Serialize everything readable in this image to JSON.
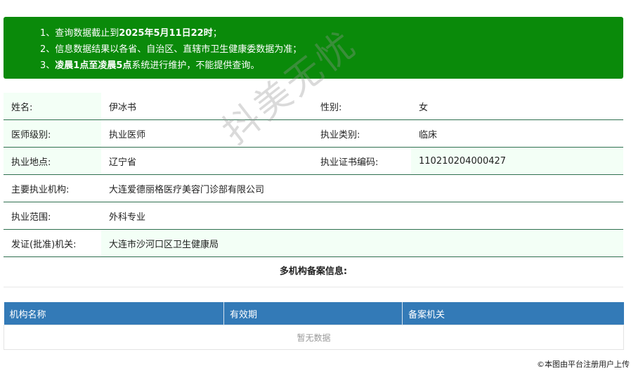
{
  "notice": {
    "line1_prefix": "1、查询数据截止到",
    "line1_bold": "2025年5月11日22时",
    "line1_suffix": "；",
    "line2": "2、信息数据结果以各省、自治区、直辖市卫生健康委数据为准；",
    "line3_prefix": "3、",
    "line3_bold": "凌晨1点至凌晨5点",
    "line3_suffix": "系统进行维护，不能提供查询。"
  },
  "info": {
    "name_label": "姓名:",
    "name_value": "伊冰书",
    "gender_label": "性别:",
    "gender_value": "女",
    "level_label": "医师级别:",
    "level_value": "执业医师",
    "type_label": "执业类别:",
    "type_value": "临床",
    "location_label": "执业地点:",
    "location_value": "辽宁省",
    "cert_label": "执业证书编码:",
    "cert_value": "110210204000427",
    "org_label": "主要执业机构:",
    "org_value": "大连爱德丽格医疗美容门诊部有限公司",
    "scope_label": "执业范围:",
    "scope_value": "外科专业",
    "authority_label": "发证(批准)机关:",
    "authority_value": "大连市沙河口区卫生健康局"
  },
  "multi": {
    "title": "多机构备案信息:",
    "columns": [
      "机构名称",
      "有效期",
      "备案机关"
    ],
    "empty_text": "暂无数据"
  },
  "watermark": "抖美无忧",
  "corner_note": "©本图由平台注册用户上传",
  "colors": {
    "notice_bg": "#0a8a0a",
    "label_bg": "#f3fff6",
    "table_header_bg": "#337ab7",
    "row_border": "#2f6f4f"
  }
}
